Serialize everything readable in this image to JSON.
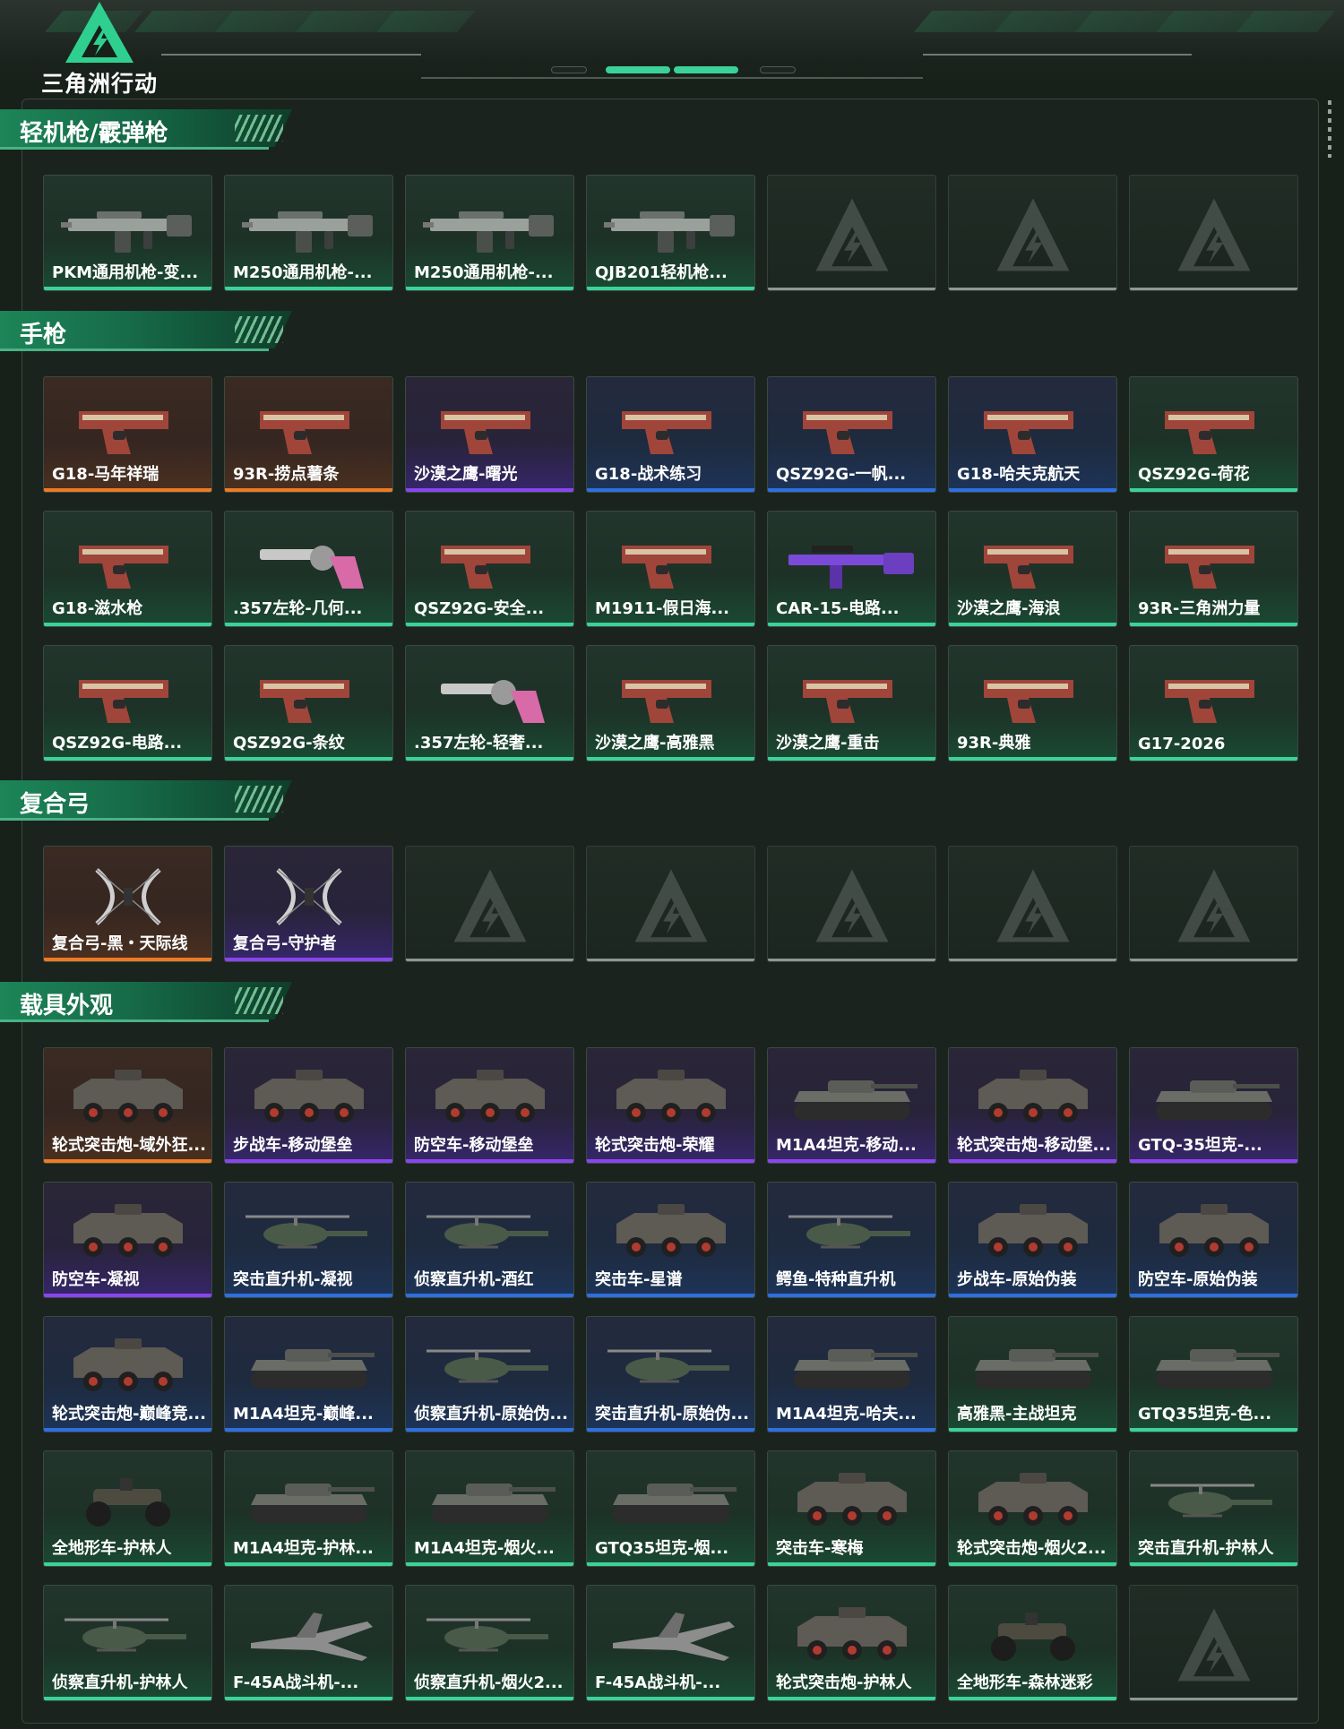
{
  "header": {
    "game_title": "三角洲行动",
    "pager": {
      "count": 4,
      "active_index": 1
    }
  },
  "colors": {
    "green": "#3cd29a",
    "blue": "#2f6fe0",
    "purple": "#8a45f0",
    "orange": "#f07a24",
    "section_green": "#1d8558"
  },
  "sections": [
    {
      "title": "轻机枪/霰弹枪",
      "items": [
        {
          "label": "PKM通用机枪-变...",
          "quality": "green",
          "icon": "machine-gun"
        },
        {
          "label": "M250通用机枪-...",
          "quality": "green",
          "icon": "machine-gun"
        },
        {
          "label": "M250通用机枪-...",
          "quality": "green",
          "icon": "machine-gun"
        },
        {
          "label": "QJB201轻机枪...",
          "quality": "green",
          "icon": "machine-gun"
        },
        {
          "label": "",
          "quality": "empty",
          "icon": ""
        },
        {
          "label": "",
          "quality": "empty",
          "icon": ""
        },
        {
          "label": "",
          "quality": "empty",
          "icon": ""
        }
      ]
    },
    {
      "title": "手枪",
      "items": [
        {
          "label": "G18-马年祥瑞",
          "quality": "orange",
          "icon": "pistol"
        },
        {
          "label": "93R-捞点薯条",
          "quality": "orange",
          "icon": "pistol"
        },
        {
          "label": "沙漠之鹰-曙光",
          "quality": "purple",
          "icon": "pistol"
        },
        {
          "label": "G18-战术练习",
          "quality": "blue",
          "icon": "pistol"
        },
        {
          "label": "QSZ92G-一帆...",
          "quality": "blue",
          "icon": "pistol"
        },
        {
          "label": "G18-哈夫克航天",
          "quality": "blue",
          "icon": "pistol"
        },
        {
          "label": "QSZ92G-荷花",
          "quality": "green",
          "icon": "pistol"
        },
        {
          "label": "G18-滋水枪",
          "quality": "green",
          "icon": "pistol"
        },
        {
          "label": ".357左轮-几何...",
          "quality": "green",
          "icon": "revolver"
        },
        {
          "label": "QSZ92G-安全...",
          "quality": "green",
          "icon": "pistol"
        },
        {
          "label": "M1911-假日海...",
          "quality": "green",
          "icon": "pistol"
        },
        {
          "label": "CAR-15-电路...",
          "quality": "green",
          "icon": "rifle"
        },
        {
          "label": "沙漠之鹰-海浪",
          "quality": "green",
          "icon": "pistol"
        },
        {
          "label": "93R-三角洲力量",
          "quality": "green",
          "icon": "pistol"
        },
        {
          "label": "QSZ92G-电路...",
          "quality": "green",
          "icon": "pistol"
        },
        {
          "label": "QSZ92G-条纹",
          "quality": "green",
          "icon": "pistol"
        },
        {
          "label": ".357左轮-轻奢...",
          "quality": "green",
          "icon": "revolver"
        },
        {
          "label": "沙漠之鹰-高雅黑",
          "quality": "green",
          "icon": "pistol"
        },
        {
          "label": "沙漠之鹰-重击",
          "quality": "green",
          "icon": "pistol"
        },
        {
          "label": "93R-典雅",
          "quality": "green",
          "icon": "pistol"
        },
        {
          "label": "G17-2026",
          "quality": "green",
          "icon": "pistol"
        }
      ]
    },
    {
      "title": "复合弓",
      "items": [
        {
          "label": "复合弓-黑・天际线",
          "quality": "orange",
          "icon": "bow"
        },
        {
          "label": "复合弓-守护者",
          "quality": "purple",
          "icon": "bow"
        },
        {
          "label": "",
          "quality": "empty",
          "icon": ""
        },
        {
          "label": "",
          "quality": "empty",
          "icon": ""
        },
        {
          "label": "",
          "quality": "empty",
          "icon": ""
        },
        {
          "label": "",
          "quality": "empty",
          "icon": ""
        },
        {
          "label": "",
          "quality": "empty",
          "icon": ""
        }
      ]
    },
    {
      "title": "载具外观",
      "items": [
        {
          "label": "轮式突击炮-域外狂...",
          "quality": "orange",
          "icon": "armored-car"
        },
        {
          "label": "步战车-移动堡垒",
          "quality": "purple",
          "icon": "armored-car"
        },
        {
          "label": "防空车-移动堡垒",
          "quality": "purple",
          "icon": "armored-car"
        },
        {
          "label": "轮式突击炮-荣耀",
          "quality": "purple",
          "icon": "armored-car"
        },
        {
          "label": "M1A4坦克-移动...",
          "quality": "purple",
          "icon": "tank"
        },
        {
          "label": "轮式突击炮-移动堡...",
          "quality": "purple",
          "icon": "armored-car"
        },
        {
          "label": "GTQ-35坦克-...",
          "quality": "purple",
          "icon": "tank"
        },
        {
          "label": "防空车-凝视",
          "quality": "purple",
          "icon": "armored-car"
        },
        {
          "label": "突击直升机-凝视",
          "quality": "blue",
          "icon": "helicopter"
        },
        {
          "label": "侦察直升机-酒红",
          "quality": "blue",
          "icon": "helicopter"
        },
        {
          "label": "突击车-星谱",
          "quality": "blue",
          "icon": "armored-car"
        },
        {
          "label": "鳄鱼-特种直升机",
          "quality": "blue",
          "icon": "helicopter"
        },
        {
          "label": "步战车-原始伪装",
          "quality": "blue",
          "icon": "armored-car"
        },
        {
          "label": "防空车-原始伪装",
          "quality": "blue",
          "icon": "armored-car"
        },
        {
          "label": "轮式突击炮-巅峰竞...",
          "quality": "blue",
          "icon": "armored-car"
        },
        {
          "label": "M1A4坦克-巅峰...",
          "quality": "blue",
          "icon": "tank"
        },
        {
          "label": "侦察直升机-原始伪...",
          "quality": "blue",
          "icon": "helicopter"
        },
        {
          "label": "突击直升机-原始伪...",
          "quality": "blue",
          "icon": "helicopter"
        },
        {
          "label": "M1A4坦克-哈夫...",
          "quality": "blue",
          "icon": "tank"
        },
        {
          "label": "高雅黑-主战坦克",
          "quality": "green",
          "icon": "tank"
        },
        {
          "label": "GTQ35坦克-色...",
          "quality": "green",
          "icon": "tank"
        },
        {
          "label": "全地形车-护林人",
          "quality": "green",
          "icon": "atv"
        },
        {
          "label": "M1A4坦克-护林...",
          "quality": "green",
          "icon": "tank"
        },
        {
          "label": "M1A4坦克-烟火...",
          "quality": "green",
          "icon": "tank"
        },
        {
          "label": "GTQ35坦克-烟...",
          "quality": "green",
          "icon": "tank"
        },
        {
          "label": "突击车-寒梅",
          "quality": "green",
          "icon": "armored-car"
        },
        {
          "label": "轮式突击炮-烟火2...",
          "quality": "green",
          "icon": "armored-car"
        },
        {
          "label": "突击直升机-护林人",
          "quality": "green",
          "icon": "helicopter"
        },
        {
          "label": "侦察直升机-护林人",
          "quality": "green",
          "icon": "helicopter"
        },
        {
          "label": "F-45A战斗机-...",
          "quality": "green",
          "icon": "jet"
        },
        {
          "label": "侦察直升机-烟火2...",
          "quality": "green",
          "icon": "helicopter"
        },
        {
          "label": "F-45A战斗机-...",
          "quality": "green",
          "icon": "jet"
        },
        {
          "label": "轮式突击炮-护林人",
          "quality": "green",
          "icon": "armored-car"
        },
        {
          "label": "全地形车-森林迷彩",
          "quality": "green",
          "icon": "atv"
        },
        {
          "label": "",
          "quality": "empty",
          "icon": ""
        }
      ]
    }
  ]
}
